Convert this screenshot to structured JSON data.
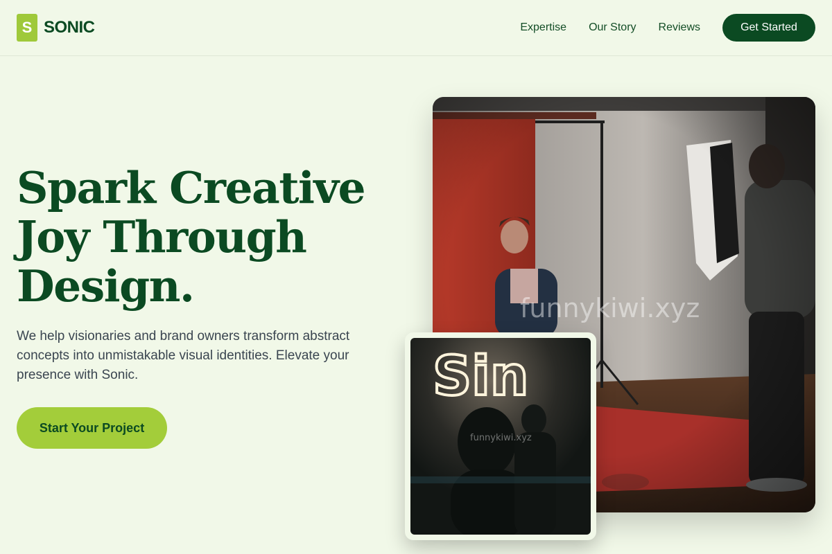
{
  "brand": {
    "logo_letter": "S",
    "name": "SONIC"
  },
  "nav": {
    "links": [
      "Expertise",
      "Our Story",
      "Reviews"
    ],
    "cta_label": "Get Started"
  },
  "hero": {
    "title": "Spark Creative Joy Through Design.",
    "subtitle": "We help visionaries and brand owners transform abstract concepts into unmistakable visual identities. Elevate your presence with Sonic.",
    "button_label": "Start Your Project"
  },
  "images": {
    "main": {
      "subject": "photo-studio-portrait-shoot",
      "watermark": "funnykiwi.xyz"
    },
    "small": {
      "subject": "neon-sign-silhouettes",
      "neon_text": "Sin",
      "watermark": "funnykiwi.xyz"
    }
  },
  "colors": {
    "background": "#f1f8e8",
    "primary_dark_green": "#0b4a22",
    "accent_lime": "#a3cd3a",
    "body_text": "#3a4550"
  }
}
